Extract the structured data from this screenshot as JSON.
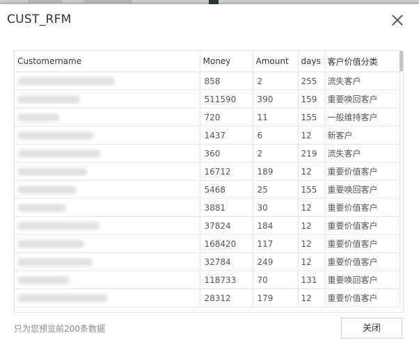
{
  "dialog": {
    "title": "CUST_RFM",
    "footnote": "只为您预览前200条数据",
    "close_button": "关闭"
  },
  "table": {
    "columns": [
      "Customername",
      "Money",
      "Amount",
      "days",
      "客户价值分类"
    ],
    "rows": [
      {
        "money": "858",
        "amount": "2",
        "days": "255",
        "category": "流失客户"
      },
      {
        "money": "511590",
        "amount": "390",
        "days": "159",
        "category": "重要唤回客户"
      },
      {
        "money": "720",
        "amount": "11",
        "days": "155",
        "category": "一般维持客户"
      },
      {
        "money": "1437",
        "amount": "6",
        "days": "12",
        "category": "新客户"
      },
      {
        "money": "360",
        "amount": "2",
        "days": "219",
        "category": "流失客户"
      },
      {
        "money": "16712",
        "amount": "189",
        "days": "12",
        "category": "重要价值客户"
      },
      {
        "money": "5468",
        "amount": "25",
        "days": "155",
        "category": "重要唤回客户"
      },
      {
        "money": "3881",
        "amount": "30",
        "days": "12",
        "category": "重要价值客户"
      },
      {
        "money": "37824",
        "amount": "184",
        "days": "12",
        "category": "重要价值客户"
      },
      {
        "money": "168420",
        "amount": "117",
        "days": "12",
        "category": "重要价值客户"
      },
      {
        "money": "32784",
        "amount": "249",
        "days": "12",
        "category": "重要价值客户"
      },
      {
        "money": "118733",
        "amount": "70",
        "days": "131",
        "category": "重要唤回客户"
      },
      {
        "money": "28312",
        "amount": "179",
        "days": "12",
        "category": "重要价值客户"
      }
    ]
  }
}
